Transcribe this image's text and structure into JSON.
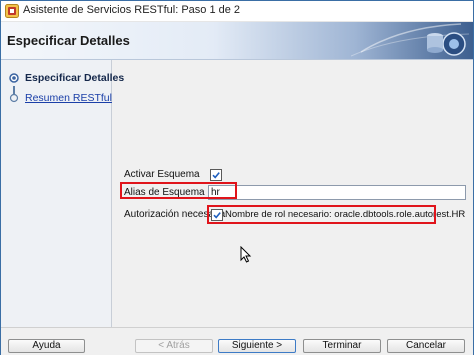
{
  "window": {
    "title": "Asistente de Servicios RESTful: Paso 1 de 2",
    "icon": "oracle-wizard-icon"
  },
  "header": {
    "title": "Especificar Detalles",
    "art_icon": "database-gears-icon"
  },
  "nav": {
    "items": [
      {
        "label": "Especificar Detalles",
        "state": "current"
      },
      {
        "label": "Resumen RESTful",
        "state": "link"
      }
    ]
  },
  "form": {
    "activar_esquema": {
      "label": "Activar Esquema",
      "checked": true
    },
    "alias_esquema": {
      "label": "Alias de Esquema",
      "value": "hr"
    },
    "autorizacion": {
      "label": "Autorización necesaria",
      "checked": true,
      "role_text": "Nombre de rol necesario: oracle.dbtools.role.autorest.HR"
    }
  },
  "footer": {
    "help_label": "Ayuda",
    "back_label": "< Atrás",
    "next_label": "Siguiente >",
    "finish_label": "Terminar",
    "cancel_label": "Cancelar"
  },
  "colors": {
    "highlight": "#e0141b",
    "header_dark": "#3d5f8f",
    "link": "#1a3fa8",
    "check": "#1f5fbf"
  }
}
